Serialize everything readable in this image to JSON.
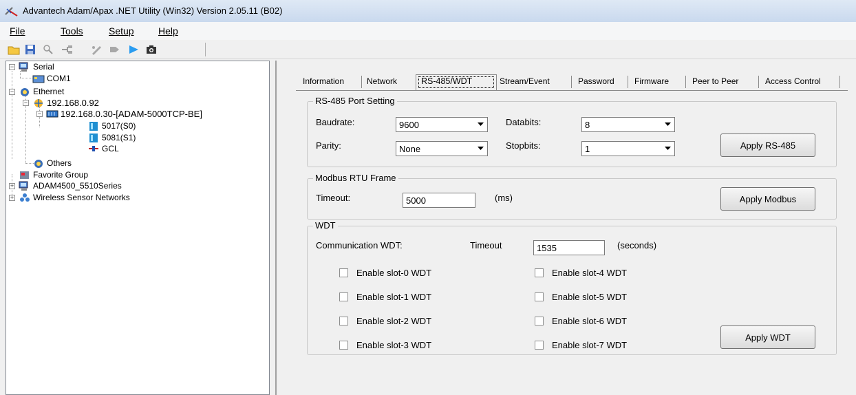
{
  "window": {
    "title": "Advantech Adam/Apax .NET Utility (Win32) Version 2.05.11 (B02)"
  },
  "menu": {
    "file": "File",
    "tools": "Tools",
    "setup": "Setup",
    "help": "Help"
  },
  "toolbar": {
    "buttons": [
      "open-icon",
      "save-icon",
      "search-icon",
      "network-scan-icon",
      "connect-icon",
      "disconnect-icon",
      "run-icon",
      "camera-icon"
    ]
  },
  "tree": {
    "serial": "Serial",
    "com1": "COM1",
    "ethernet": "Ethernet",
    "ip_host": "192.168.0.92",
    "device": "192.168.0.30-[ADAM-5000TCP-BE]",
    "slot0": "5017(S0)",
    "slot1": "5081(S1)",
    "gcl": "GCL",
    "others": "Others",
    "favorite": "Favorite Group",
    "adam4500": "ADAM4500_5510Series",
    "wsn": "Wireless Sensor Networks"
  },
  "tabs": [
    "Information",
    "Network",
    "RS-485/WDT",
    "Stream/Event",
    "Password",
    "Firmware",
    "Peer to Peer",
    "Access Control"
  ],
  "active_tab": "RS-485/WDT",
  "rs485": {
    "group_title": "RS-485 Port Setting",
    "baudrate_label": "Baudrate:",
    "baudrate_value": "9600",
    "databits_label": "Databits:",
    "databits_value": "8",
    "parity_label": "Parity:",
    "parity_value": "None",
    "stopbits_label": "Stopbits:",
    "stopbits_value": "1",
    "apply_label": "Apply RS-485"
  },
  "modbus": {
    "group_title": "Modbus RTU Frame",
    "timeout_label": "Timeout:",
    "timeout_value": "5000",
    "unit": "(ms)",
    "apply_label": "Apply Modbus"
  },
  "wdt": {
    "group_title": "WDT",
    "comm_label": "Communication WDT:",
    "timeout_label": "Timeout",
    "timeout_value": "1535",
    "unit": "(seconds)",
    "slots": [
      {
        "label": "Enable slot-0 WDT",
        "checked": false
      },
      {
        "label": "Enable slot-1 WDT",
        "checked": false
      },
      {
        "label": "Enable slot-2 WDT",
        "checked": false
      },
      {
        "label": "Enable slot-3 WDT",
        "checked": false
      },
      {
        "label": "Enable slot-4 WDT",
        "checked": false
      },
      {
        "label": "Enable slot-5 WDT",
        "checked": false
      },
      {
        "label": "Enable slot-6 WDT",
        "checked": false
      },
      {
        "label": "Enable slot-7 WDT",
        "checked": false
      }
    ],
    "apply_label": "Apply WDT"
  }
}
